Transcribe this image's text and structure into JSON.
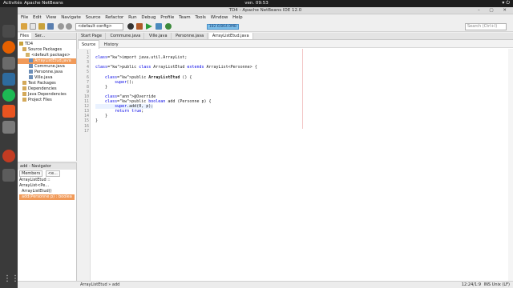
{
  "topbar": {
    "activities": "Activités",
    "app": "Apache NetBeans",
    "clock": "ven. 09:53"
  },
  "window": {
    "title": "TD4 - Apache NetBeans IDE 12.0"
  },
  "menu": [
    "File",
    "Edit",
    "View",
    "Navigate",
    "Source",
    "Refactor",
    "Run",
    "Debug",
    "Profile",
    "Team",
    "Tools",
    "Window",
    "Help"
  ],
  "toolbar": {
    "config": "<default config>",
    "memory": "182.6/864.0MB",
    "search_placeholder": "Search (Ctrl+I)"
  },
  "project_panel": {
    "tabs": [
      "Files",
      "Ser..."
    ],
    "tree": [
      {
        "label": "TD4",
        "indent": 0
      },
      {
        "label": "Source Packages",
        "indent": 1
      },
      {
        "label": "<default package>",
        "indent": 2
      },
      {
        "label": "ArrayListEtud.java",
        "indent": 3,
        "selected": true
      },
      {
        "label": "Commune.java",
        "indent": 3
      },
      {
        "label": "Personne.java",
        "indent": 3
      },
      {
        "label": "Ville.java",
        "indent": 3
      },
      {
        "label": "Test Packages",
        "indent": 1
      },
      {
        "label": "Dependencies",
        "indent": 1
      },
      {
        "label": "Java Dependencies",
        "indent": 1
      },
      {
        "label": "Project Files",
        "indent": 1
      }
    ]
  },
  "navigator": {
    "title": "add - Navigator",
    "filter1": "Members",
    "filter2": "<e...",
    "header": "ArrayListEtud :: ArrayList<Pe...",
    "items": [
      {
        "label": "ArrayListEtud()",
        "selected": false
      },
      {
        "label": "add(Personne p) : boolea",
        "selected": true
      }
    ]
  },
  "editor": {
    "tabs": [
      "Start Page",
      "Commune.java",
      "Ville.java",
      "Personne.java",
      "ArrayListEtud.java"
    ],
    "active_tab": "ArrayListEtud.java",
    "subtabs": [
      "Source",
      "History"
    ],
    "lines": [
      "",
      "import java.util.ArrayList;",
      "",
      "public class ArrayListEtud extends ArrayList<Personne> {",
      "",
      "    public ArrayListEtud () {",
      "        super();",
      "    }",
      "",
      "    @Override",
      "    public boolean add (Personne p) {",
      "        super.add(0, p);",
      "        return true;",
      "    }",
      "}",
      "",
      ""
    ],
    "highlight_line": 12
  },
  "statusbar": {
    "breadcrumb1": "ArrayListEtud",
    "breadcrumb2": "add",
    "position": "12:24/1:9",
    "mode": "INS Unix (LF)"
  },
  "colors": {
    "selection": "#f19a59",
    "keyword": "#0000e6"
  }
}
